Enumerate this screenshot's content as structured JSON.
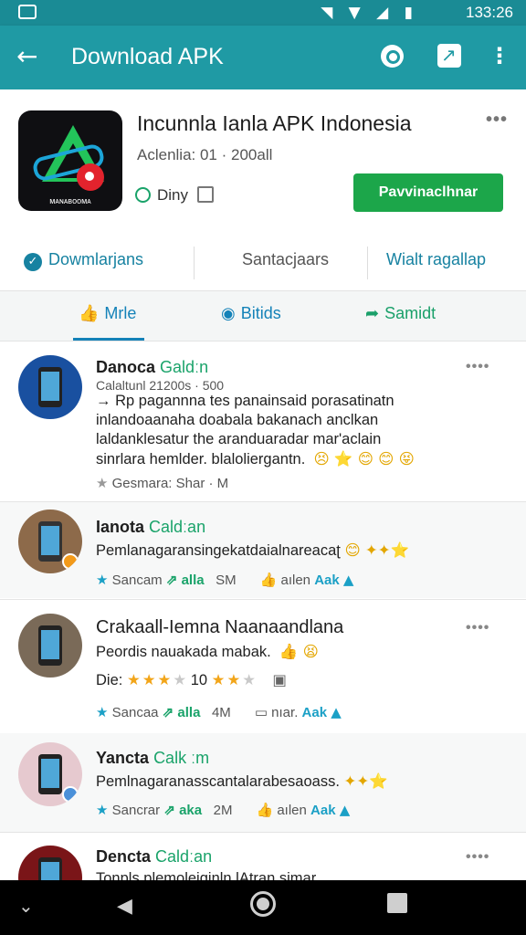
{
  "status_bar": {
    "time": "133:26",
    "icons": "◥ ▼ ◢ ▮"
  },
  "toolbar": {
    "back_icon": "←",
    "title": "Download APK",
    "more_icon": "⋮"
  },
  "app": {
    "icon_label": "ᴍᴀɴᴀʙᴏᴏᴍᴀ",
    "name": "Incunnla Ianla APK Indonesia",
    "meta": "Aclenlia: 01 · 200all",
    "tag": "Diny",
    "more": "•••",
    "download_label": "Pavvinaclhnar"
  },
  "quick_links": [
    "Dowmlarjans",
    "Santacjaars",
    "Wialt ragallap"
  ],
  "tabs": [
    {
      "label": "Mrle",
      "icon": "👍"
    },
    {
      "label": "Bitids",
      "icon": "◉"
    },
    {
      "label": "Samidt",
      "icon": "➦"
    }
  ],
  "comments": [
    {
      "name": "Danoca",
      "name_green": "Galdːn",
      "sub": "Calaltunl 21200s · 500",
      "lines": [
        "→ Rp pagannna tes panainsaid porasatinatn",
        "inlandoaanaha doabala bakanach anclkan",
        "laldanklesatur the aranduaradar mar'aclain",
        "sinrlara hemlder. blaloliergantn."
      ],
      "emojis": "😣 ⭐ 😊 😊 😝",
      "foot": "Gesmara: Shar · M"
    },
    {
      "name": "Ianota",
      "name_green": "Caldːan",
      "text": "Pemlanagaransingekatdaialnareacaʈ",
      "emojis": "😊 ✦✦⭐",
      "foot_left": "Sancam",
      "foot_green": "alla",
      "foot_size": "SM",
      "foot_right": "aılen",
      "foot_blue": "Aak"
    },
    {
      "name": "Crakaall-Iemna Naanaandlana",
      "text": "Peordis nauakada mabak.",
      "emojis": "👍 😫",
      "rating_label": "Die:",
      "rating_num": "10",
      "foot_left": "Sancaa",
      "foot_green": "alla",
      "foot_size": "4M",
      "foot_right": "nıar.",
      "foot_blue": "Aak"
    },
    {
      "name": "Yancta",
      "name_green": "Calk ːm",
      "text": "Pemlnagaranasscantalarabesaoass.",
      "emojis": "✦✦⭐",
      "foot_left": "Sancrar",
      "foot_green": "aka",
      "foot_size": "2M",
      "foot_right": "aılen",
      "foot_blue": "Aak"
    },
    {
      "name": "Dencta",
      "name_green": "Caldːan",
      "text": "Tonpls plemolejginln lAtran simar"
    }
  ]
}
